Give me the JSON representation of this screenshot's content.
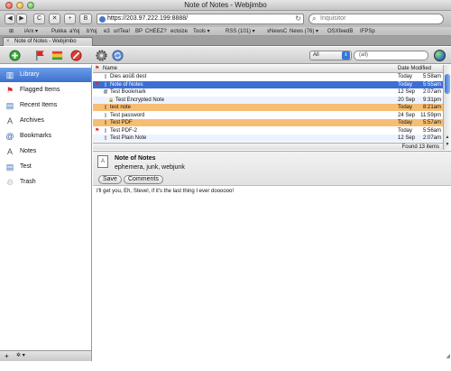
{
  "window": {
    "title": "Note of Notes - Webjimbo"
  },
  "browser": {
    "url": "https://203.97.222.199:8888/",
    "search_placeholder": "Inquisitor",
    "nav_buttons": {
      "back": "◀",
      "forward": "▶",
      "reload": "C",
      "stop": "✕",
      "add": "+",
      "bookmark": "B"
    },
    "bookmarks": [
      "iArx ▾",
      "Pukka",
      "aYoj",
      "bYoj",
      "e3",
      "urlTea!",
      "BP",
      "CHEEZ?",
      "ectoize",
      "Tools ▾",
      "RSS (101) ▾",
      "xNewsC",
      "News (76) ▾",
      "OSXfeedB",
      "IFPSp"
    ],
    "tab": {
      "label": "Note of Notes - Webjimbo"
    }
  },
  "filter": {
    "selected": "All",
    "query": "(all)"
  },
  "sidebar": {
    "items": [
      {
        "label": "Library",
        "icon": "library-icon",
        "glyph": "▥",
        "color": "#c8781e",
        "selected": true
      },
      {
        "label": "Flagged Items",
        "icon": "flag-icon",
        "glyph": "⚑",
        "color": "#d22a2a",
        "selected": false
      },
      {
        "label": "Recent Items",
        "icon": "recent-items-icon",
        "glyph": "▤",
        "color": "#3d6fb8",
        "selected": false
      },
      {
        "label": "Archives",
        "icon": "archives-icon",
        "glyph": "A",
        "color": "#555555",
        "selected": false
      },
      {
        "label": "Bookmarks",
        "icon": "bookmark-at-icon",
        "glyph": "@",
        "color": "#2b56a8",
        "selected": false
      },
      {
        "label": "Notes",
        "icon": "notes-icon",
        "glyph": "A",
        "color": "#555555",
        "selected": false
      },
      {
        "label": "Test",
        "icon": "folder-icon",
        "glyph": "▤",
        "color": "#3d6fb8",
        "selected": false
      },
      {
        "label": "Trash",
        "icon": "trash-icon",
        "glyph": "♲",
        "color": "#666666",
        "selected": false
      }
    ],
    "bottom": {
      "add": "+",
      "actions": "✲ ▾"
    }
  },
  "list": {
    "columns": {
      "flag": "⚑",
      "name": "Name",
      "date": "Date Modified"
    },
    "rows": [
      {
        "flag": "",
        "icon": "document-icon",
        "glyph": "▯",
        "name": "Dies aoüß dest",
        "day": "Today",
        "time": "5:58am",
        "state": "normal",
        "indent": 0
      },
      {
        "flag": "⚑",
        "icon": "document-icon",
        "glyph": "▯",
        "name": "Note of Notes",
        "day": "Today",
        "time": "5:55am",
        "state": "selected",
        "indent": 0
      },
      {
        "flag": "",
        "icon": "bookmark-icon",
        "glyph": "@",
        "name": "Test Bookmark",
        "day": "12 Sep",
        "time": "2:07am",
        "state": "normal",
        "indent": 0
      },
      {
        "flag": "",
        "icon": "lock-icon",
        "glyph": "🔒",
        "name": "Test Encrypted Note",
        "day": "20 Sep",
        "time": "9:31pm",
        "state": "alt",
        "indent": 1
      },
      {
        "flag": "",
        "icon": "document-icon",
        "glyph": "▯",
        "name": "test note",
        "day": "Today",
        "time": "8:21am",
        "state": "highlight",
        "indent": 0
      },
      {
        "flag": "",
        "icon": "document-icon",
        "glyph": "▯",
        "name": "Test password",
        "day": "24 Sep",
        "time": "11:59pm",
        "state": "normal",
        "indent": 0
      },
      {
        "flag": "",
        "icon": "pdf-icon",
        "glyph": "▯",
        "name": "Test PDF",
        "day": "Today",
        "time": "5:57am",
        "state": "highlight",
        "indent": 0
      },
      {
        "flag": "⚑",
        "icon": "pdf-icon",
        "glyph": "▯",
        "name": "Test PDF-2",
        "day": "Today",
        "time": "5:56am",
        "state": "normal",
        "indent": 0
      },
      {
        "flag": "",
        "icon": "document-icon",
        "glyph": "▯",
        "name": "Test Plain Note",
        "day": "12 Sep",
        "time": "2:07am",
        "state": "alt",
        "indent": 0
      }
    ],
    "found": "Found 13 items"
  },
  "detail": {
    "icon_glyph": "A",
    "title": "Note of Notes",
    "tags": "ephemera, junk, webjunk",
    "save_label": "Save",
    "comments_label": "Comments",
    "body": "I'll get you, Eh, Steve!, if it's the last thing I ever doooooo!"
  }
}
